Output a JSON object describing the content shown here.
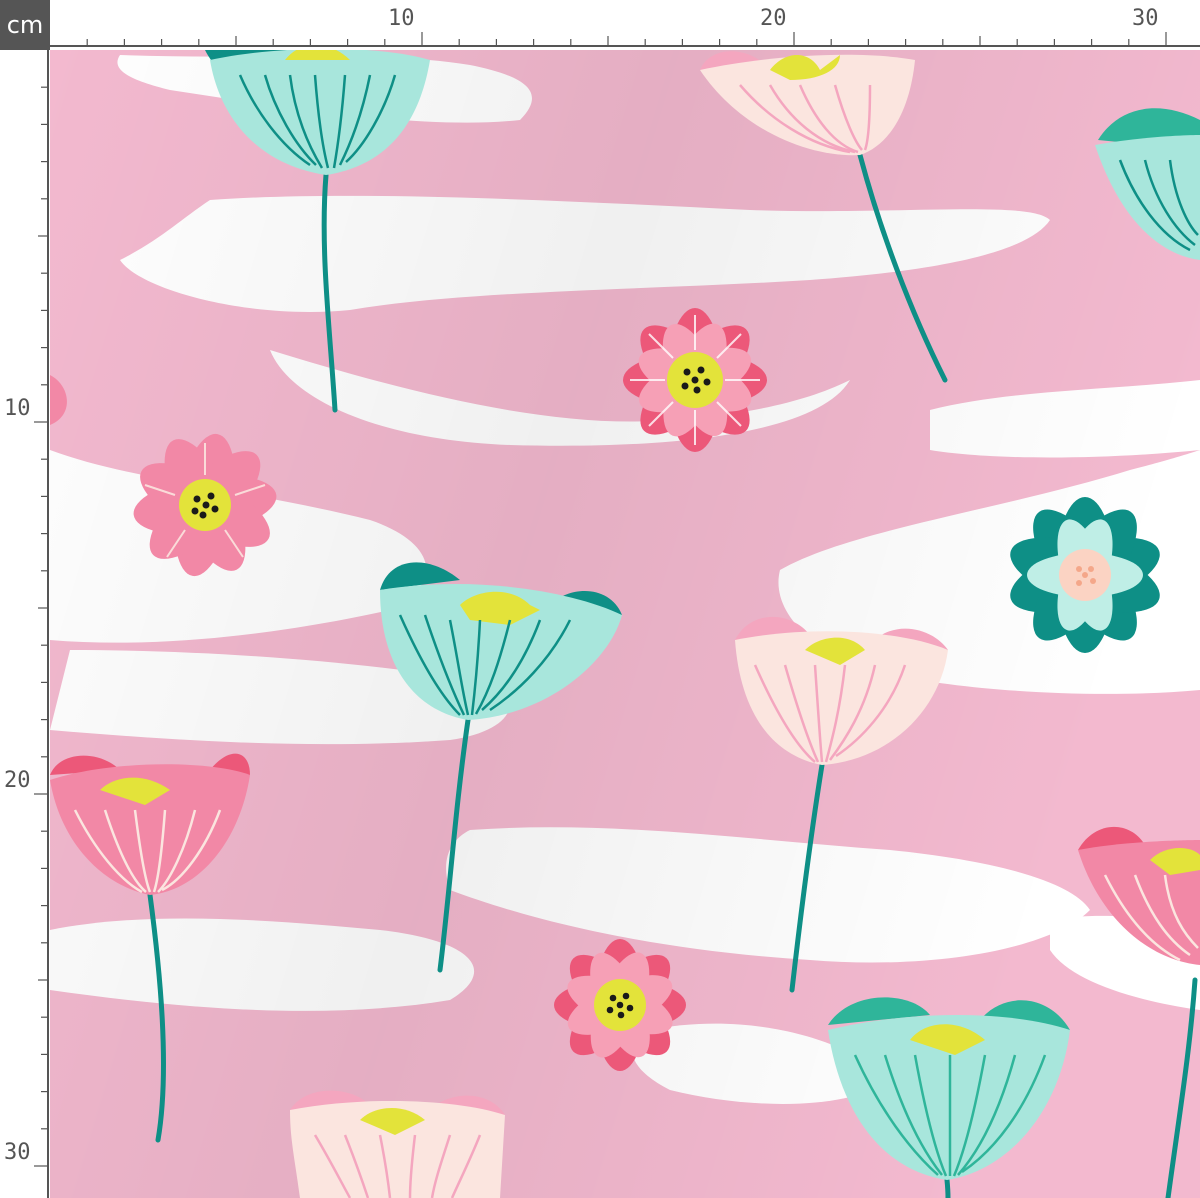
{
  "ruler": {
    "unit_label": "cm",
    "top_labels": [
      "10",
      "20",
      "30"
    ],
    "left_labels": [
      "10",
      "20",
      "30"
    ]
  },
  "fabric": {
    "background_color": "#f3b9cf",
    "cloud_color": "#ffffff",
    "pink_light": "#f4a6bf",
    "pink_deep": "#ec5879",
    "teal_deep": "#0e8f86",
    "teal_light": "#a8e6dc",
    "cream": "#fbe5df",
    "yellow_center": "#e3e33a"
  }
}
